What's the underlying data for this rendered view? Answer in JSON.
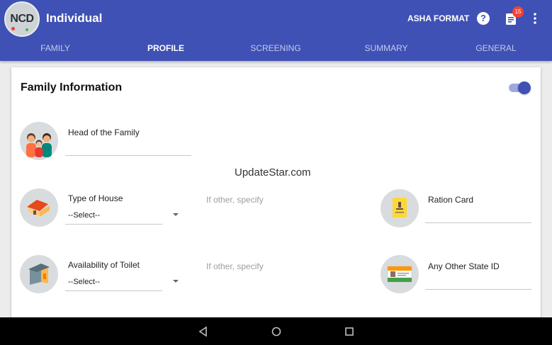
{
  "header": {
    "logo_text": "NCD",
    "title": "Individual",
    "asha_label": "ASHA FORMAT",
    "help_glyph": "?",
    "notification_count": "15",
    "primary_color": "#3f51b5"
  },
  "tabs": [
    {
      "label": "FAMILY",
      "active": false
    },
    {
      "label": "PROFILE",
      "active": true
    },
    {
      "label": "SCREENING",
      "active": false
    },
    {
      "label": "SUMMARY",
      "active": false
    },
    {
      "label": "GENERAL",
      "active": false
    }
  ],
  "section": {
    "title": "Family Information",
    "toggle_on": true
  },
  "fields": {
    "head_of_family": {
      "label": "Head of the Family",
      "value": "",
      "icon": "family-icon"
    },
    "type_of_house": {
      "label": "Type of House",
      "value": "--Select--",
      "other_hint": "If other, specify",
      "icon": "house-icon"
    },
    "toilet": {
      "label": "Availability of Toilet",
      "value": "--Select--",
      "other_hint": "If other, specify",
      "icon": "toilet-icon"
    },
    "ration_card": {
      "label": "Ration Card",
      "value": "",
      "icon": "ration-card-icon"
    },
    "state_id": {
      "label": "Any Other State ID",
      "value": "",
      "icon": "id-card-icon"
    }
  },
  "watermark": "UpdateStar.com"
}
